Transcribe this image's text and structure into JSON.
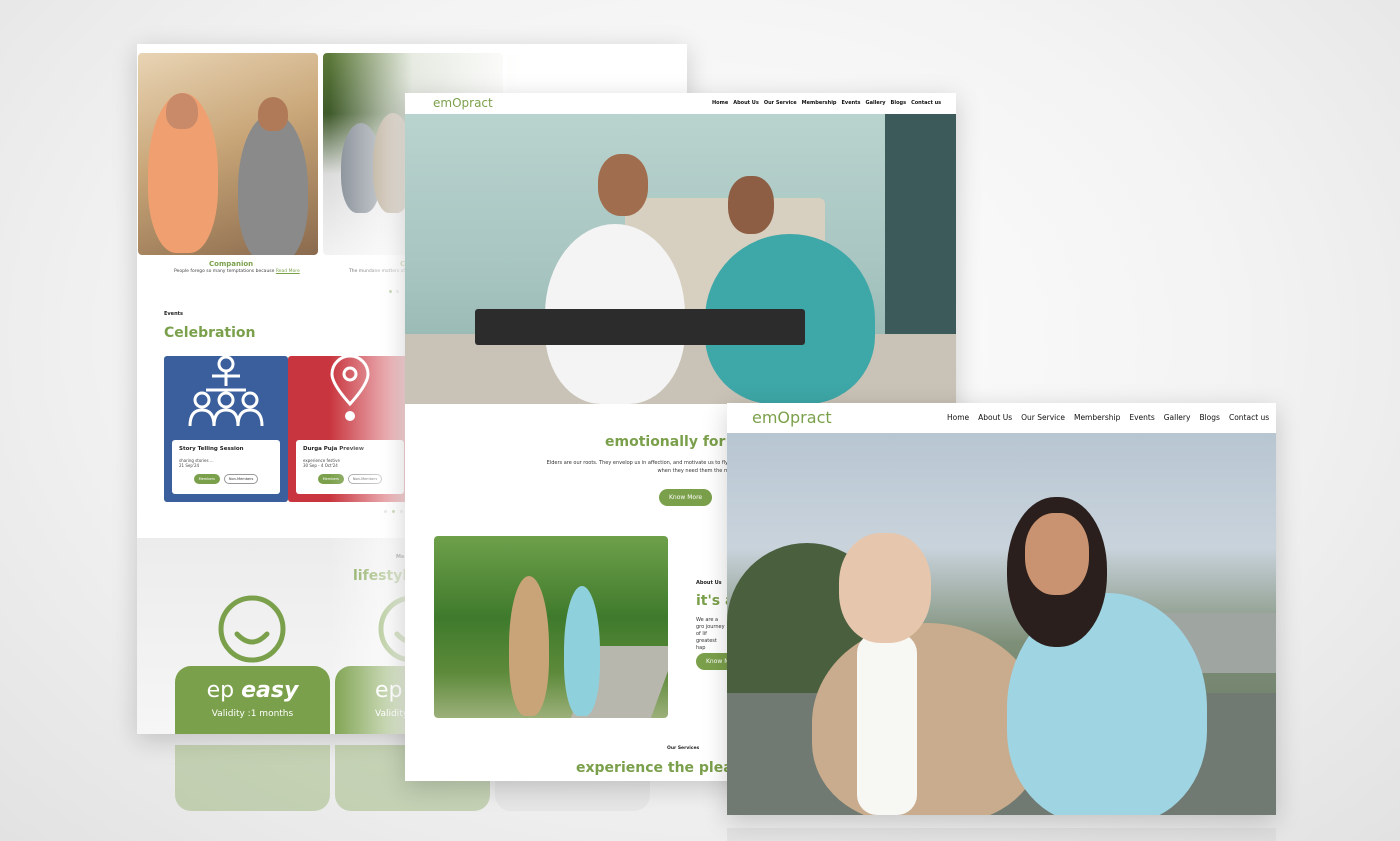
{
  "back_page": {
    "cards": [
      {
        "title": "Companion",
        "desc": "People forego so many temptations because",
        "link": "Read More"
      },
      {
        "title": "C",
        "desc": "The mundane matters of eve"
      }
    ],
    "events_label": "Events",
    "events_heading": "Celebration",
    "events": [
      {
        "title": "Story Telling Session",
        "desc": "sharing stories ...",
        "date": "21 Sep'24",
        "tag_members": "Members",
        "tag_non": "Non-Members",
        "color": "#3b5f9c"
      },
      {
        "title": "Durga Puja Preview",
        "desc": "experience festive",
        "date": "30 Sep - 4 Oct'24",
        "tag_members": "Members",
        "tag_non": "Non-Members",
        "color": "#c9353e"
      }
    ],
    "membership_label": "Me",
    "membership_heading": "lifestyl",
    "plans": [
      {
        "name_prefix": "ep",
        "name_bold": "easy",
        "validity": "Validity :1 months"
      },
      {
        "name_prefix": "ep",
        "validity": "Validity"
      }
    ]
  },
  "middle_page": {
    "logo": "emOpract",
    "nav": [
      "Home",
      "About Us",
      "Our Service",
      "Membership",
      "Events",
      "Gallery",
      "Blogs",
      "Contact us"
    ],
    "tagline_heading": "emotionally for el",
    "tagline_body_1": "Elders are our roots. They envelop us in affection, and motivate us to fly high. In turn, we need to be their shade and su",
    "tagline_body_2": "when they need them the most",
    "know_more": "Know More",
    "about_label": "About Us",
    "about_heading": "it's a",
    "about_body": "We are a gro journey of lif greatest hap",
    "about_btn": "Know M",
    "services_label": "Our Services",
    "services_heading": "experience the pleasu"
  },
  "front_page": {
    "logo": "emOpract",
    "nav": [
      "Home",
      "About Us",
      "Our Service",
      "Membership",
      "Events",
      "Gallery",
      "Blogs",
      "Contact us"
    ]
  },
  "colors": {
    "brand_green": "#7ba04b",
    "event_blue": "#3b5f9c",
    "event_red": "#c9353e"
  }
}
